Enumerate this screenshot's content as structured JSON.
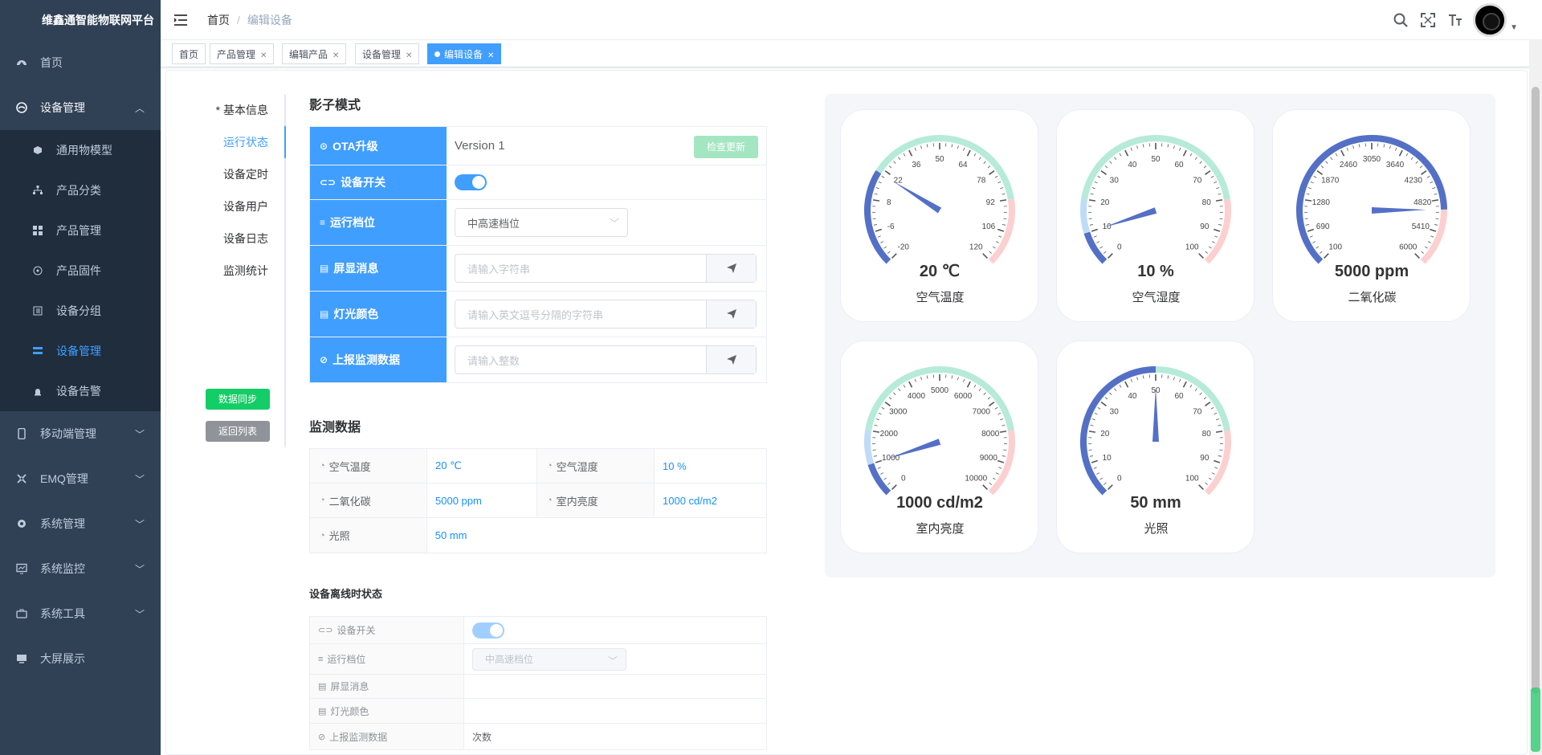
{
  "app": {
    "title": "维鑫通智能物联网平台"
  },
  "sidebar": {
    "items": [
      {
        "label": "首页",
        "icon": "dashboard-icon"
      },
      {
        "label": "设备管理",
        "icon": "device-icon",
        "open": true
      },
      {
        "label": "移动端管理",
        "icon": "mobile-icon"
      },
      {
        "label": "EMQ管理",
        "icon": "emq-icon"
      },
      {
        "label": "系统管理",
        "icon": "settings-icon"
      },
      {
        "label": "系统监控",
        "icon": "monitor-icon"
      },
      {
        "label": "系统工具",
        "icon": "tool-icon"
      },
      {
        "label": "大屏展示",
        "icon": "screen-icon"
      }
    ],
    "sub": [
      {
        "label": "通用物模型",
        "icon": "cube-icon"
      },
      {
        "label": "产品分类",
        "icon": "tree-icon"
      },
      {
        "label": "产品管理",
        "icon": "grid-icon"
      },
      {
        "label": "产品固件",
        "icon": "firmware-icon"
      },
      {
        "label": "设备分组",
        "icon": "group-icon"
      },
      {
        "label": "设备管理",
        "icon": "list-icon",
        "active": true
      },
      {
        "label": "设备告警",
        "icon": "alarm-icon"
      }
    ]
  },
  "breadcrumb": {
    "home": "首页",
    "current": "编辑设备"
  },
  "tags": [
    {
      "label": "首页"
    },
    {
      "label": "产品管理"
    },
    {
      "label": "编辑产品"
    },
    {
      "label": "设备管理"
    },
    {
      "label": "编辑设备",
      "active": true
    }
  ],
  "tabs": [
    "* 基本信息",
    "运行状态",
    "设备定时",
    "设备用户",
    "设备日志",
    "监测统计"
  ],
  "buttons": {
    "sync": "数据同步",
    "back": "返回列表",
    "check_update": "检查更新"
  },
  "shadow": {
    "title": "影子模式",
    "ota_label": "OTA升级",
    "ota_version": "Version 1",
    "switch_label": "设备开关",
    "gear_label": "运行档位",
    "gear_value": "中高速档位",
    "screen_label": "屏显消息",
    "screen_placeholder": "请输入字符串",
    "light_label": "灯光颜色",
    "light_placeholder": "请输入英文逗号分隔的字符串",
    "report_label": "上报监测数据",
    "report_placeholder": "请输入整数"
  },
  "monitor": {
    "title": "监测数据",
    "items": [
      {
        "label": "空气温度",
        "value": "20 ℃"
      },
      {
        "label": "空气湿度",
        "value": "10 %"
      },
      {
        "label": "二氧化碳",
        "value": "5000 ppm"
      },
      {
        "label": "室内亮度",
        "value": "1000 cd/m2"
      },
      {
        "label": "光照",
        "value": "50 mm"
      }
    ]
  },
  "offline": {
    "title": "设备离线时状态",
    "switch_label": "设备开关",
    "gear_label": "运行档位",
    "gear_value": "中高速档位",
    "screen_label": "屏显消息",
    "light_label": "灯光颜色",
    "report_label": "上报监测数据",
    "report_value": "次数"
  },
  "gauges": [
    {
      "name": "空气温度",
      "readout": "20 ℃",
      "min": -20,
      "max": 120,
      "value": 20,
      "ticks": [
        "-20",
        "-6",
        "8",
        "22",
        "36",
        "50",
        "64",
        "78",
        "92",
        "106",
        "120"
      ]
    },
    {
      "name": "空气湿度",
      "readout": "10 %",
      "min": 0,
      "max": 100,
      "value": 10,
      "ticks": [
        "0",
        "10",
        "20",
        "30",
        "40",
        "50",
        "60",
        "70",
        "80",
        "90",
        "100"
      ]
    },
    {
      "name": "二氧化碳",
      "readout": "5000 ppm",
      "min": 100,
      "max": 6000,
      "value": 5000,
      "ticks": [
        "100",
        "690",
        "1280",
        "1870",
        "2460",
        "3050",
        "3640",
        "4230",
        "4820",
        "5410",
        "6000"
      ]
    },
    {
      "name": "室内亮度",
      "readout": "1000 cd/m2",
      "min": 0,
      "max": 10000,
      "value": 1000,
      "ticks": [
        "0",
        "1000",
        "2000",
        "3000",
        "4000",
        "5000",
        "6000",
        "7000",
        "8000",
        "9000",
        "10000"
      ]
    },
    {
      "name": "光照",
      "readout": "50 mm",
      "min": 0,
      "max": 100,
      "value": 50,
      "ticks": [
        "0",
        "10",
        "20",
        "30",
        "40",
        "50",
        "60",
        "70",
        "80",
        "90",
        "100"
      ]
    }
  ],
  "colors": {
    "primary": "#409eff",
    "sidebar": "#304156",
    "gauge_pointer": "#5470c6",
    "gauge_green": "#b6ead9",
    "gauge_red": "#fcd0d0",
    "gauge_blue_light": "#bfdcf7"
  }
}
